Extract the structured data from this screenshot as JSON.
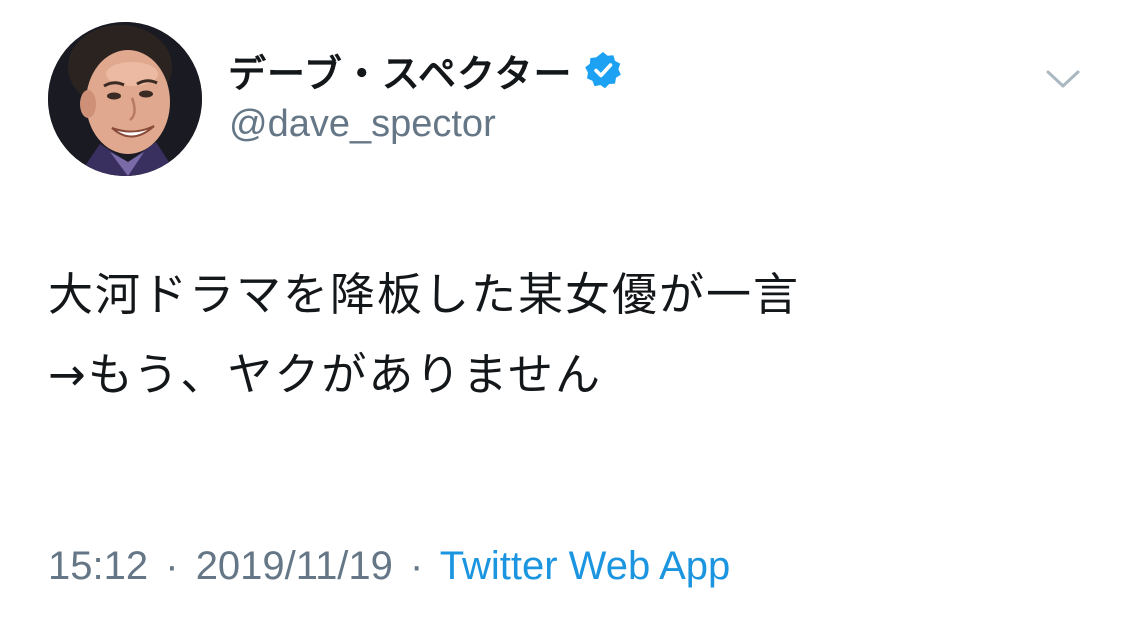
{
  "tweet": {
    "author": {
      "display_name": "デーブ・スペクター",
      "handle": "@dave_spector",
      "verified": true,
      "verified_icon": "verified-badge-icon",
      "avatar": "author-avatar"
    },
    "menu_icon": "chevron-down-icon",
    "text_lines": [
      "大河ドラマを降板した某女優が一言",
      "→もう、ヤクがありません"
    ],
    "meta": {
      "time": "15:12",
      "separator": "·",
      "date": "2019/11/19",
      "source": "Twitter Web App"
    }
  },
  "colors": {
    "text_primary": "#14171a",
    "text_secondary": "#657786",
    "link": "#1b95e0",
    "verified_blue": "#1da1f2",
    "background": "#ffffff"
  }
}
